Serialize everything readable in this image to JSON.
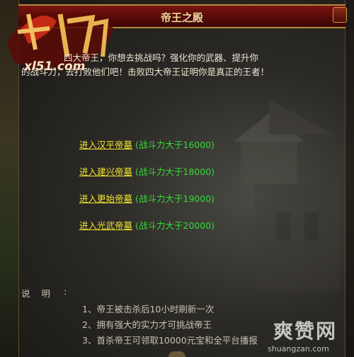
{
  "window": {
    "title": "帝王之殿"
  },
  "logo": {
    "site": "xl51.com",
    "alt": "logo-emblem"
  },
  "intro": {
    "line1": "四大帝王，你想去挑战吗？强化你的武器、提升你",
    "line2": "的战斗力，去打败他们吧！击败四大帝王证明你是真正的王者！"
  },
  "entries": [
    {
      "label": "进入汉平帝墓",
      "requirement": "(战斗力大于16000)"
    },
    {
      "label": "进入建兴帝墓",
      "requirement": "(战斗力大于18000)"
    },
    {
      "label": "进入更始帝墓",
      "requirement": "(战斗力大于19000)"
    },
    {
      "label": "进入光武帝墓",
      "requirement": "(战斗力大于20000)"
    }
  ],
  "notes": {
    "title": "说明",
    "colon": ":",
    "items": [
      "1、帝王被击杀后10小时刷新一次",
      "2、拥有强大的实力才可挑战帝王",
      "3、首杀帝王可领取10000元宝和全平台播报"
    ]
  },
  "watermark": {
    "big": "爽赞网",
    "small": "shuangzan.com"
  },
  "colors": {
    "link": "#f0e230",
    "requirement": "#37d83a",
    "title": "#f4d79a",
    "titlebar": "#5a0c08"
  }
}
